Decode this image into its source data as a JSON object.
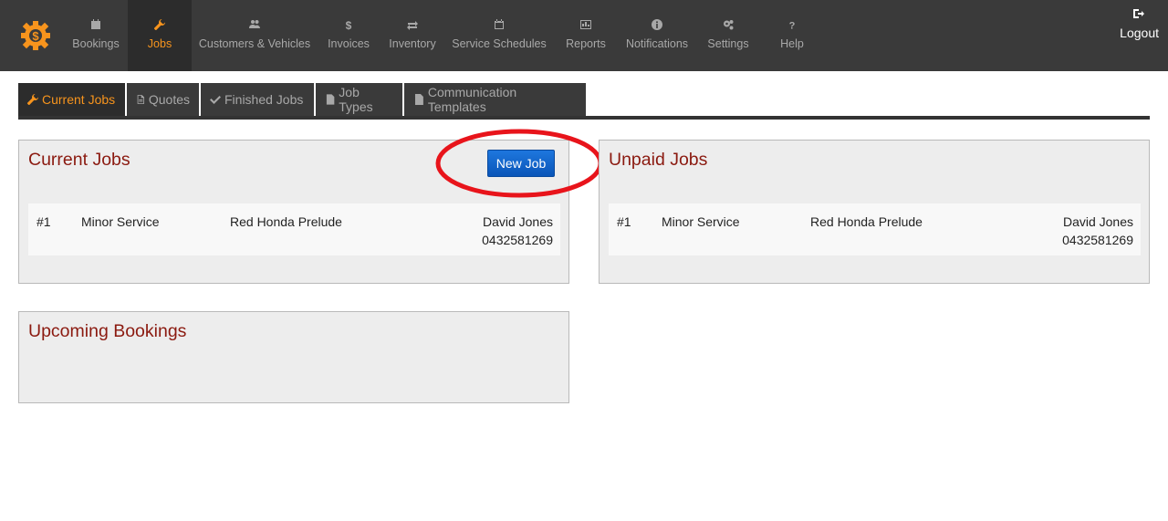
{
  "nav": {
    "items": [
      {
        "label": "Bookings",
        "icon": "calendar-icon"
      },
      {
        "label": "Jobs",
        "icon": "wrench-icon",
        "active": true
      },
      {
        "label": "Customers & Vehicles",
        "icon": "users-icon"
      },
      {
        "label": "Invoices",
        "icon": "dollar-icon"
      },
      {
        "label": "Inventory",
        "icon": "exchange-icon"
      },
      {
        "label": "Service Schedules",
        "icon": "calendar-empty-icon"
      },
      {
        "label": "Reports",
        "icon": "chart-icon"
      },
      {
        "label": "Notifications",
        "icon": "info-icon"
      },
      {
        "label": "Settings",
        "icon": "gears-icon"
      },
      {
        "label": "Help",
        "icon": "question-icon"
      }
    ],
    "logout_label": "Logout",
    "accent_color": "#f7941d"
  },
  "subtabs": [
    {
      "label": "Current Jobs",
      "icon": "wrench-icon",
      "active": true
    },
    {
      "label": "Quotes",
      "icon": "document-icon"
    },
    {
      "label": "Finished Jobs",
      "icon": "check-icon"
    },
    {
      "label": "Job Types",
      "icon": "file-icon"
    },
    {
      "label": "Communication Templates",
      "icon": "file-icon"
    }
  ],
  "current_jobs": {
    "title": "Current Jobs",
    "new_job_label": "New Job",
    "rows": [
      {
        "number": "#1",
        "type": "Minor Service",
        "vehicle": "Red Honda Prelude",
        "customer": "David Jones",
        "phone": "0432581269"
      }
    ]
  },
  "unpaid_jobs": {
    "title": "Unpaid Jobs",
    "rows": [
      {
        "number": "#1",
        "type": "Minor Service",
        "vehicle": "Red Honda Prelude",
        "customer": "David Jones",
        "phone": "0432581269"
      }
    ]
  },
  "upcoming_bookings": {
    "title": "Upcoming Bookings"
  },
  "colors": {
    "panel_title": "#8b1a10",
    "nav_bg": "#3a3a3a",
    "button_blue": "#1667cc",
    "annotation_red": "#e8141b"
  }
}
